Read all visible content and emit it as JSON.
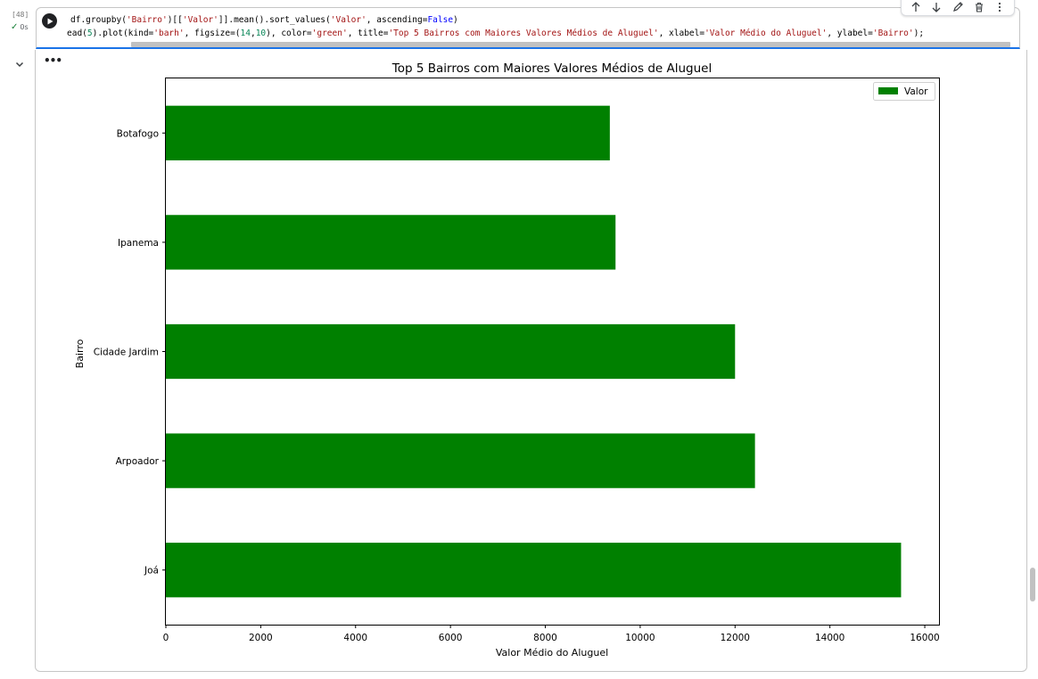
{
  "cell": {
    "execution_count": "[48]",
    "exec_time": "0s",
    "code_line1_segments": [
      {
        "t": "df.groupby(",
        "c": ""
      },
      {
        "t": "'Bairro'",
        "c": "tok-str"
      },
      {
        "t": ")[[",
        "c": ""
      },
      {
        "t": "'Valor'",
        "c": "tok-str"
      },
      {
        "t": "]].mean().sort_values(",
        "c": ""
      },
      {
        "t": "'Valor'",
        "c": "tok-str"
      },
      {
        "t": ", ascending=",
        "c": ""
      },
      {
        "t": "False",
        "c": "tok-kw"
      },
      {
        "t": ")",
        "c": ""
      }
    ],
    "code_line2_segments": [
      {
        "t": "ead(",
        "c": ""
      },
      {
        "t": "5",
        "c": "tok-num"
      },
      {
        "t": ").plot(kind=",
        "c": ""
      },
      {
        "t": "'barh'",
        "c": "tok-str"
      },
      {
        "t": ", figsize=(",
        "c": ""
      },
      {
        "t": "14",
        "c": "tok-num"
      },
      {
        "t": ",",
        "c": ""
      },
      {
        "t": "10",
        "c": "tok-num"
      },
      {
        "t": "), color=",
        "c": ""
      },
      {
        "t": "'green'",
        "c": "tok-str"
      },
      {
        "t": ", title=",
        "c": ""
      },
      {
        "t": "'Top 5 Bairros com Maiores Valores Médios de Aluguel'",
        "c": "tok-str"
      },
      {
        "t": ", xlabel=",
        "c": ""
      },
      {
        "t": "'Valor Médio do Aluguel'",
        "c": "tok-str"
      },
      {
        "t": ", ylabel=",
        "c": ""
      },
      {
        "t": "'Bairro'",
        "c": "tok-str"
      },
      {
        "t": ");",
        "c": ""
      }
    ]
  },
  "toolbar": {
    "icons": [
      "arrow-up-icon",
      "arrow-down-icon",
      "edit-icon",
      "delete-icon",
      "more-vert-icon"
    ]
  },
  "output": {
    "more_label": "•••"
  },
  "chart_data": {
    "type": "bar",
    "orientation": "horizontal",
    "title": "Top 5 Bairros com Maiores Valores Médios de Aluguel",
    "xlabel": "Valor Médio do Aluguel",
    "ylabel": "Bairro",
    "categories": [
      "Joá",
      "Arpoador",
      "Cidade Jardim",
      "Ipanema",
      "Botafogo"
    ],
    "series": [
      {
        "name": "Valor",
        "values": [
          15500,
          12420,
          12000,
          9480,
          9360
        ],
        "color": "#008000"
      }
    ],
    "xlim": [
      0,
      16300
    ],
    "xticks": [
      0,
      2000,
      4000,
      6000,
      8000,
      10000,
      12000,
      14000,
      16000
    ],
    "grid": false,
    "legend": "top-right"
  }
}
